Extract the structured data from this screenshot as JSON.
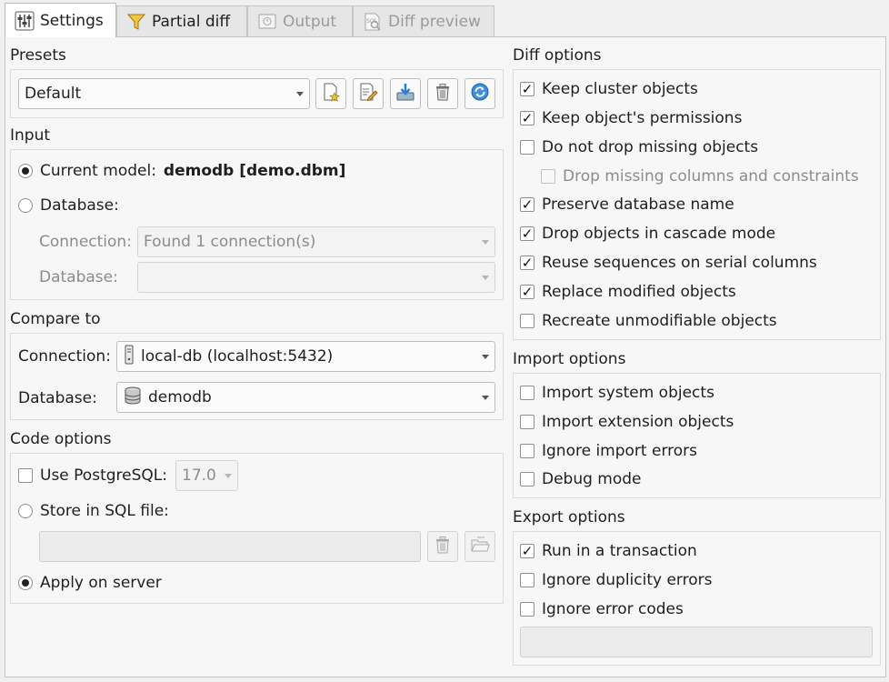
{
  "tabs": [
    {
      "label": "Settings",
      "icon": "settings-sliders-icon",
      "active": true
    },
    {
      "label": "Partial diff",
      "icon": "funnel-icon",
      "active": false
    },
    {
      "label": "Output",
      "icon": "output-icon",
      "active": false
    },
    {
      "label": "Diff preview",
      "icon": "sql-preview-icon",
      "active": false
    }
  ],
  "presets": {
    "title": "Presets",
    "selected": "Default"
  },
  "input": {
    "title": "Input",
    "current_model_label": "Current model:",
    "current_model_value": "demodb [demo.dbm]",
    "database_radio_label": "Database:",
    "connection_label": "Connection:",
    "connection_value": "Found 1 connection(s)",
    "database_label": "Database:",
    "database_value": ""
  },
  "compare_to": {
    "title": "Compare to",
    "connection_label": "Connection:",
    "connection_value": "local-db (localhost:5432)",
    "database_label": "Database:",
    "database_value": "demodb"
  },
  "code_options": {
    "title": "Code options",
    "use_pg_label": "Use PostgreSQL:",
    "pg_version": "17.0",
    "store_sql_label": "Store in SQL file:",
    "sql_file_value": "",
    "apply_label": "Apply on server"
  },
  "diff_options": {
    "title": "Diff options",
    "items": [
      {
        "label": "Keep cluster objects",
        "checked": true
      },
      {
        "label": "Keep object's permissions",
        "checked": true
      },
      {
        "label": "Do not drop missing objects",
        "checked": false
      },
      {
        "label": "Drop missing columns and constraints",
        "checked": false,
        "disabled": true
      },
      {
        "label": "Preserve database name",
        "checked": true
      },
      {
        "label": "Drop objects in cascade mode",
        "checked": true
      },
      {
        "label": "Reuse sequences on serial columns",
        "checked": true
      },
      {
        "label": "Replace modified objects",
        "checked": true
      },
      {
        "label": "Recreate unmodifiable objects",
        "checked": false
      }
    ]
  },
  "import_options": {
    "title": "Import options",
    "items": [
      {
        "label": "Import system objects",
        "checked": false
      },
      {
        "label": "Import extension objects",
        "checked": false
      },
      {
        "label": "Ignore import errors",
        "checked": false
      },
      {
        "label": "Debug mode",
        "checked": false
      }
    ]
  },
  "export_options": {
    "title": "Export options",
    "items": [
      {
        "label": "Run in a transaction",
        "checked": true
      },
      {
        "label": "Ignore duplicity errors",
        "checked": false
      },
      {
        "label": "Ignore error codes",
        "checked": false
      }
    ],
    "error_codes_value": ""
  }
}
